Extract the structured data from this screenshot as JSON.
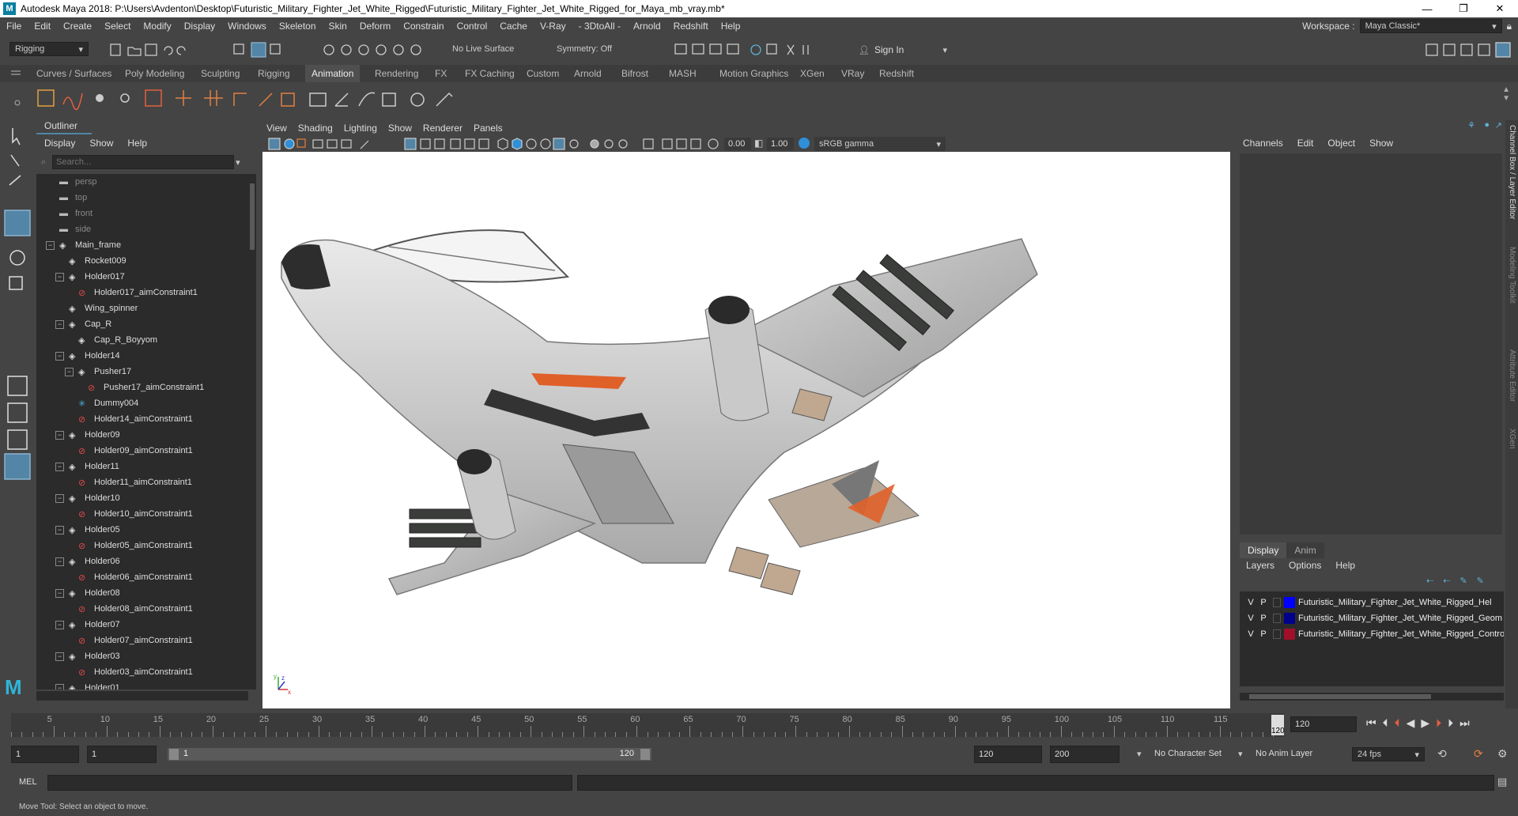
{
  "titlebar": {
    "title": "Autodesk Maya 2018: P:\\Users\\Avdenton\\Desktop\\Futuristic_Military_Fighter_Jet_White_Rigged\\Futuristic_Military_Fighter_Jet_White_Rigged_for_Maya_mb_vray.mb*",
    "minimize": "—",
    "maximize": "❐",
    "close": "✕"
  },
  "menubar": {
    "items": [
      "File",
      "Edit",
      "Create",
      "Select",
      "Modify",
      "Display",
      "Windows",
      "Skeleton",
      "Skin",
      "Deform",
      "Constrain",
      "Control",
      "Cache",
      "V-Ray",
      "- 3DtoAll -",
      "Arnold",
      "Redshift",
      "Help"
    ],
    "workspace_label": "Workspace :",
    "workspace_value": "Maya Classic*"
  },
  "statusline": {
    "menuset": "Rigging",
    "live_surface": "No Live Surface",
    "symmetry": "Symmetry: Off",
    "sign_in": "Sign In"
  },
  "shelf": {
    "tabs": [
      "Curves / Surfaces",
      "Poly Modeling",
      "Sculpting",
      "Rigging",
      "Animation",
      "Rendering",
      "FX",
      "FX Caching",
      "Custom",
      "Arnold",
      "Bifrost",
      "MASH",
      "Motion Graphics",
      "XGen",
      "VRay",
      "Redshift"
    ],
    "active_tab": "Animation"
  },
  "outliner": {
    "title": "Outliner",
    "menu": [
      "Display",
      "Show",
      "Help"
    ],
    "search_placeholder": "Search...",
    "rows": [
      {
        "label": "persp",
        "kind": "camera",
        "indent": 1,
        "dim": true
      },
      {
        "label": "top",
        "kind": "camera",
        "indent": 1,
        "dim": true
      },
      {
        "label": "front",
        "kind": "camera",
        "indent": 1,
        "dim": true
      },
      {
        "label": "side",
        "kind": "camera",
        "indent": 1,
        "dim": true
      },
      {
        "label": "Main_frame",
        "kind": "transform",
        "indent": 1,
        "expand": "−"
      },
      {
        "label": "Rocket009",
        "kind": "transform",
        "indent": 2
      },
      {
        "label": "Holder017",
        "kind": "transform",
        "indent": 2,
        "expand": "−"
      },
      {
        "label": "Holder017_aimConstraint1",
        "kind": "constraint",
        "indent": 3
      },
      {
        "label": "Wing_spinner",
        "kind": "transform",
        "indent": 2
      },
      {
        "label": "Cap_R",
        "kind": "transform",
        "indent": 2,
        "expand": "−"
      },
      {
        "label": "Cap_R_Boyyom",
        "kind": "transform",
        "indent": 3
      },
      {
        "label": "Holder14",
        "kind": "transform",
        "indent": 2,
        "expand": "−"
      },
      {
        "label": "Pusher17",
        "kind": "transform",
        "indent": 3,
        "expand": "−"
      },
      {
        "label": "Pusher17_aimConstraint1",
        "kind": "constraint",
        "indent": 4
      },
      {
        "label": "Dummy004",
        "kind": "locator",
        "indent": 3
      },
      {
        "label": "Holder14_aimConstraint1",
        "kind": "constraint",
        "indent": 3
      },
      {
        "label": "Holder09",
        "kind": "transform",
        "indent": 2,
        "expand": "−"
      },
      {
        "label": "Holder09_aimConstraint1",
        "kind": "constraint",
        "indent": 3
      },
      {
        "label": "Holder11",
        "kind": "transform",
        "indent": 2,
        "expand": "−"
      },
      {
        "label": "Holder11_aimConstraint1",
        "kind": "constraint",
        "indent": 3
      },
      {
        "label": "Holder10",
        "kind": "transform",
        "indent": 2,
        "expand": "−"
      },
      {
        "label": "Holder10_aimConstraint1",
        "kind": "constraint",
        "indent": 3
      },
      {
        "label": "Holder05",
        "kind": "transform",
        "indent": 2,
        "expand": "−"
      },
      {
        "label": "Holder05_aimConstraint1",
        "kind": "constraint",
        "indent": 3
      },
      {
        "label": "Holder06",
        "kind": "transform",
        "indent": 2,
        "expand": "−"
      },
      {
        "label": "Holder06_aimConstraint1",
        "kind": "constraint",
        "indent": 3
      },
      {
        "label": "Holder08",
        "kind": "transform",
        "indent": 2,
        "expand": "−"
      },
      {
        "label": "Holder08_aimConstraint1",
        "kind": "constraint",
        "indent": 3
      },
      {
        "label": "Holder07",
        "kind": "transform",
        "indent": 2,
        "expand": "−"
      },
      {
        "label": "Holder07_aimConstraint1",
        "kind": "constraint",
        "indent": 3
      },
      {
        "label": "Holder03",
        "kind": "transform",
        "indent": 2,
        "expand": "−"
      },
      {
        "label": "Holder03_aimConstraint1",
        "kind": "constraint",
        "indent": 3
      },
      {
        "label": "Holder01",
        "kind": "transform",
        "indent": 2,
        "expand": "−"
      }
    ]
  },
  "viewport": {
    "menu": [
      "View",
      "Shading",
      "Lighting",
      "Show",
      "Renderer",
      "Panels"
    ],
    "exposure": "0.00",
    "gamma": "1.00",
    "color_space": "sRGB gamma",
    "axis_x": "x",
    "axis_y": "y",
    "axis_z": "z"
  },
  "channelbox": {
    "menu": [
      "Channels",
      "Edit",
      "Object",
      "Show"
    ]
  },
  "layereditor": {
    "tabs": [
      "Display",
      "Anim"
    ],
    "active_tab": "Display",
    "menu": [
      "Layers",
      "Options",
      "Help"
    ],
    "layers": [
      {
        "v": "V",
        "p": "P",
        "color": "#0000ff",
        "name": "Futuristic_Military_Fighter_Jet_White_Rigged_Hel"
      },
      {
        "v": "V",
        "p": "P",
        "color": "#00008b",
        "name": "Futuristic_Military_Fighter_Jet_White_Rigged_Geom"
      },
      {
        "v": "V",
        "p": "P",
        "color": "#a0102a",
        "name": "Futuristic_Military_Fighter_Jet_White_Rigged_Contro"
      }
    ]
  },
  "sidetabs": [
    "Channel Box / Layer Editor",
    "Modeling Toolkit",
    "Attribute Editor",
    "XGen"
  ],
  "timeline": {
    "ticks": [
      "5",
      "10",
      "15",
      "20",
      "25",
      "30",
      "35",
      "40",
      "45",
      "50",
      "55",
      "60",
      "65",
      "70",
      "75",
      "80",
      "85",
      "90",
      "95",
      "100",
      "105",
      "110",
      "115",
      "120"
    ],
    "current_frame": "120",
    "frame_field": "120"
  },
  "rangebar": {
    "start": "1",
    "playback_start": "1",
    "slider_start": "1",
    "slider_end": "120",
    "playback_end": "120",
    "end": "200",
    "character_set": "No Character Set",
    "anim_layer": "No Anim Layer",
    "fps": "24 fps"
  },
  "cmdline": {
    "label": "MEL"
  },
  "helpline": {
    "text": "Move Tool: Select an object to move."
  },
  "colors": {
    "accent": "#5285a6",
    "panel": "#444444",
    "field": "#2b2b2b",
    "timeline_marker": "#c83232"
  }
}
